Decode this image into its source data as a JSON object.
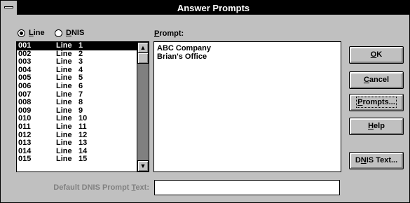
{
  "window": {
    "title": "Answer Prompts"
  },
  "mode": {
    "line_label_prefix": "",
    "line_label_u": "L",
    "line_label_rest": "ine",
    "dnis_label_u": "D",
    "dnis_label_rest": "NIS",
    "selected": "Line"
  },
  "list": {
    "items": [
      {
        "code": "001",
        "name": "Line",
        "num": "1"
      },
      {
        "code": "002",
        "name": "Line",
        "num": "2"
      },
      {
        "code": "003",
        "name": "Line",
        "num": "3"
      },
      {
        "code": "004",
        "name": "Line",
        "num": "4"
      },
      {
        "code": "005",
        "name": "Line",
        "num": "5"
      },
      {
        "code": "006",
        "name": "Line",
        "num": "6"
      },
      {
        "code": "007",
        "name": "Line",
        "num": "7"
      },
      {
        "code": "008",
        "name": "Line",
        "num": "8"
      },
      {
        "code": "009",
        "name": "Line",
        "num": "9"
      },
      {
        "code": "010",
        "name": "Line",
        "num": "10"
      },
      {
        "code": "011",
        "name": "Line",
        "num": "11"
      },
      {
        "code": "012",
        "name": "Line",
        "num": "12"
      },
      {
        "code": "013",
        "name": "Line",
        "num": "13"
      },
      {
        "code": "014",
        "name": "Line",
        "num": "14"
      },
      {
        "code": "015",
        "name": "Line",
        "num": "15"
      }
    ],
    "selected_index": 0,
    "scroll_up_glyph": "▲",
    "scroll_down_glyph": "▼"
  },
  "prompt": {
    "label_u": "P",
    "label_rest": "rompt:",
    "lines": [
      "ABC Company",
      "Brian's Office"
    ]
  },
  "buttons": {
    "ok_u": "O",
    "ok_rest": "K",
    "cancel_u": "C",
    "cancel_rest": "ancel",
    "prompts_u": "P",
    "prompts_rest": "rompts...",
    "help_u": "H",
    "help_rest": "elp",
    "dnis_pre": "D",
    "dnis_u": "N",
    "dnis_rest": "IS Text..."
  },
  "default_dnis": {
    "label_pre": "Default DNIS Prompt ",
    "label_u": "T",
    "label_rest": "ext:",
    "value": ""
  }
}
